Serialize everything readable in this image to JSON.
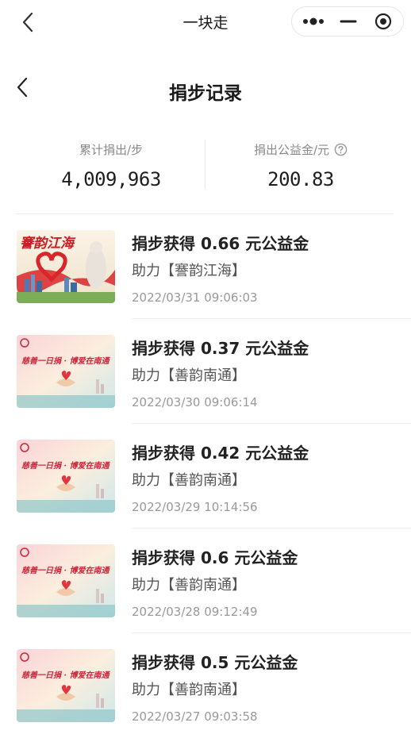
{
  "navbar": {
    "title": "一块走",
    "back_icon": "chevron-left-icon",
    "more_icon": "more-dots-icon",
    "minimize_icon": "minimize-icon",
    "close_icon": "target-close-icon"
  },
  "header": {
    "title": "捐步记录",
    "back_icon": "chevron-left-icon"
  },
  "stats": {
    "donated_steps_label": "累计捐出/步",
    "donated_steps_value": "4,009,963",
    "fund_label": "捐出公益金/元",
    "fund_value": "200.83",
    "help_icon": "question-circle-icon"
  },
  "records": [
    {
      "title": "捐步获得 0.66 元公益金",
      "subtitle": "助力【謇韵江海】",
      "time": "2022/03/31 09:06:03",
      "thumb_text": "謇韵江海",
      "thumb": "jianyun"
    },
    {
      "title": "捐步获得 0.37 元公益金",
      "subtitle": "助力【善韵南通】",
      "time": "2022/03/30 09:06:14",
      "thumb_text": "慈善一日捐 · 博爱在南通",
      "thumb": "shanyun"
    },
    {
      "title": "捐步获得 0.42 元公益金",
      "subtitle": "助力【善韵南通】",
      "time": "2022/03/29 10:14:56",
      "thumb_text": "慈善一日捐 · 博爱在南通",
      "thumb": "shanyun"
    },
    {
      "title": "捐步获得 0.6 元公益金",
      "subtitle": "助力【善韵南通】",
      "time": "2022/03/28 09:12:49",
      "thumb_text": "慈善一日捐 · 博爱在南通",
      "thumb": "shanyun"
    },
    {
      "title": "捐步获得 0.5 元公益金",
      "subtitle": "助力【善韵南通】",
      "time": "2022/03/27 09:03:58",
      "thumb_text": "慈善一日捐 · 博爱在南通",
      "thumb": "shanyun"
    }
  ]
}
